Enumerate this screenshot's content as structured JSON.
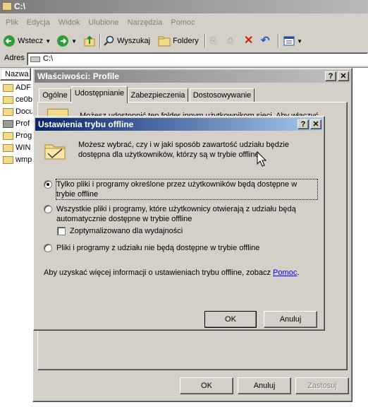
{
  "explorer": {
    "title": "C:\\",
    "menu": [
      "Plik",
      "Edycja",
      "Widok",
      "Ulubione",
      "Narzędzia",
      "Pomoc"
    ],
    "toolbar": {
      "back": "Wstecz",
      "search": "Wyszukaj",
      "folders": "Foldery"
    },
    "address": {
      "label": "Adres",
      "value": "C:\\"
    },
    "list": {
      "column_name": "Nazwa",
      "items": [
        {
          "label": "ADF",
          "icon": "folder-icon"
        },
        {
          "label": "ce0b",
          "icon": "folder-icon"
        },
        {
          "label": "Docu",
          "icon": "folder-icon"
        },
        {
          "label": "Prof",
          "icon": "shared-folder-icon"
        },
        {
          "label": "Prog",
          "icon": "folder-icon"
        },
        {
          "label": "WIN",
          "icon": "folder-icon"
        },
        {
          "label": "wmp",
          "icon": "folder-icon"
        }
      ]
    }
  },
  "properties": {
    "title": "Właściwości: Profile",
    "tabs": [
      "Ogólne",
      "Udostępnianie",
      "Zabezpieczenia",
      "Dostosowywanie"
    ],
    "active_tab": "Udostępnianie",
    "partial_text": "Możesz udostępnić ten folder innym użytkownikom sieci. Aby włączyć",
    "ok": "OK",
    "cancel": "Anuluj",
    "apply": "Zastosuj"
  },
  "offline": {
    "title": "Ustawienia trybu offline",
    "description": "Możesz wybrać, czy i w jaki sposób zawartość udziału będzie dostępna dla użytkowników, którzy są w trybie offline.",
    "options": [
      {
        "label": "Tylko pliki i programy określone przez użytkowników będą dostępne w trybie offline",
        "selected": true
      },
      {
        "label": "Wszystkie pliki i programy, które użytkownicy otwierają z udziału będą automatycznie dostępne w trybie offline",
        "selected": false
      },
      {
        "label": "Pliki i programy z udziału nie będą dostępne w trybie offline",
        "selected": false
      }
    ],
    "checkbox": {
      "label": "Zoptymalizowano dla wydajności",
      "checked": false
    },
    "more_info": "Aby uzyskać więcej informacji o ustawieniach trybu offline, zobacz",
    "help_link": "Pomoc",
    "ok": "OK",
    "cancel": "Anuluj"
  },
  "caption_buttons": {
    "help": "?",
    "close": "✕"
  }
}
